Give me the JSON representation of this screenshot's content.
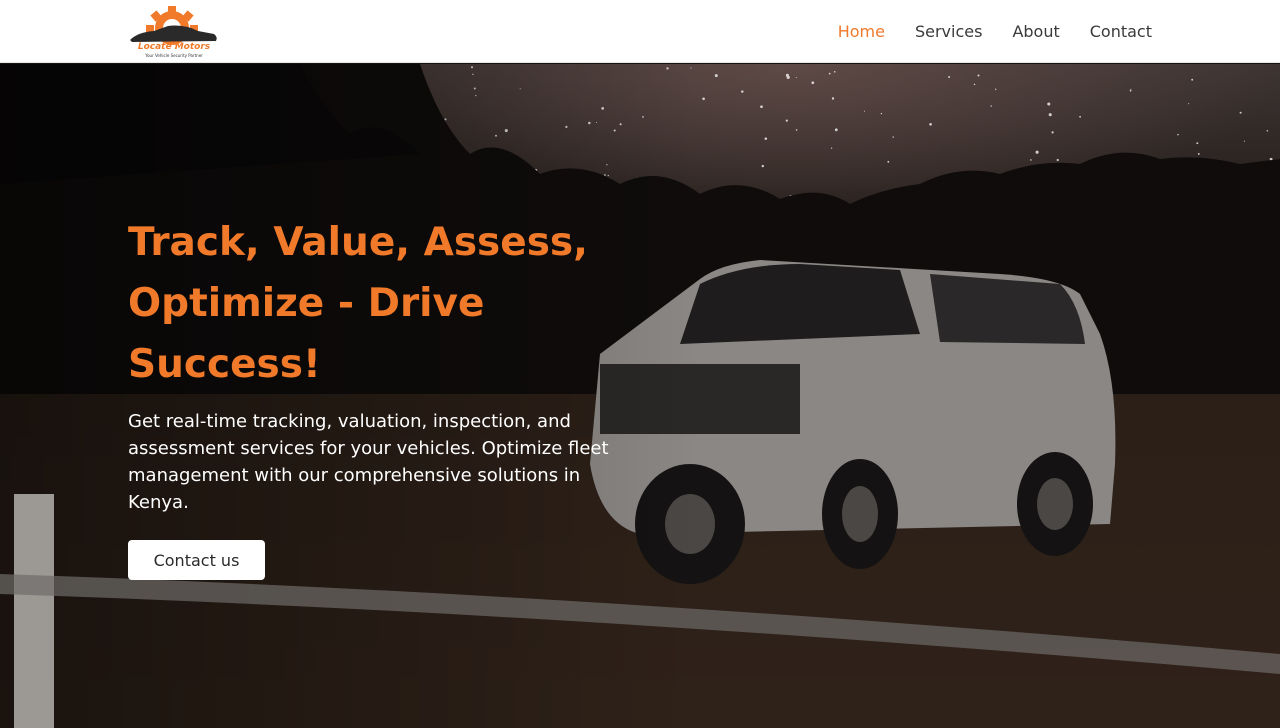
{
  "header": {
    "logo": {
      "brand": "Locate Motors",
      "tagline": "Your Vehicle Security Partner",
      "icon": "gear-car-logo"
    },
    "nav": [
      {
        "label": "Home",
        "active": true
      },
      {
        "label": "Services",
        "active": false
      },
      {
        "label": "About",
        "active": false
      },
      {
        "label": "Contact",
        "active": false
      }
    ]
  },
  "hero": {
    "title": "Track, Value, Assess, Optimize - Drive Success!",
    "description": "Get real-time tracking, valuation, inspection, and assessment services for your vehicles. Optimize fleet management with our comprehensive solutions in Kenya.",
    "cta_label": "Contact us",
    "background": "night-sky-suv-photo"
  },
  "colors": {
    "accent": "#f07a2a",
    "nav_text": "#3a3a3a",
    "header_bg": "#ffffff"
  }
}
